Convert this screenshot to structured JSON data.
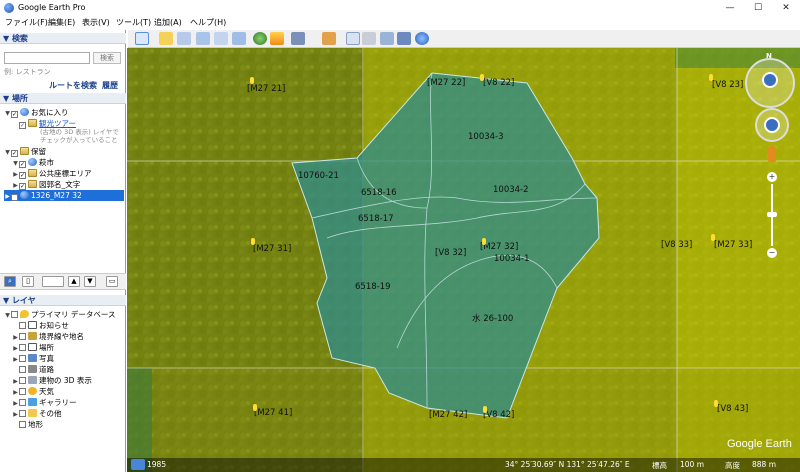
{
  "window": {
    "title": "Google Earth Pro",
    "minimize": "—",
    "maximize": "☐",
    "close": "✕"
  },
  "menu": [
    "ファイル(F)",
    "編集(E)",
    "表示(V)",
    "ツール(T)",
    "追加(A)",
    "ヘルプ(H)"
  ],
  "search": {
    "header": "▼ 検索",
    "placeholder": "",
    "button": "検索",
    "hint": "例: レストラン",
    "route": "ルートを検索",
    "history": "履歴"
  },
  "places": {
    "header": "▼ 場所",
    "items": [
      {
        "label": "お気に入り"
      },
      {
        "label": "観光ツアー"
      },
      {
        "label": "(古地の 3D 表示) レイヤで"
      },
      {
        "label": "チェックが入っていること"
      },
      {
        "label": "保留"
      },
      {
        "label": "萩市"
      },
      {
        "label": "公共座標エリア"
      },
      {
        "label": "図郭名_文字"
      },
      {
        "label": "1326_M27 32"
      }
    ]
  },
  "layers": {
    "header": "▼ レイヤ",
    "items": [
      {
        "label": "プライマリ データベース"
      },
      {
        "label": "お知らせ"
      },
      {
        "label": "境界線や地名"
      },
      {
        "label": "場所"
      },
      {
        "label": "写真"
      },
      {
        "label": "道路"
      },
      {
        "label": "建物の 3D 表示"
      },
      {
        "label": "天気"
      },
      {
        "label": "ギャラリー"
      },
      {
        "label": "その他"
      },
      {
        "label": "地形"
      }
    ]
  },
  "map": {
    "grid_labels": [
      "[M27 21]",
      "[M27 22]",
      "[V8 22]",
      "[V8 23]",
      "[M27 31]",
      "[V8 32]",
      "[M27 32]",
      "[V8 33]",
      "[M27 33]",
      "[M27 41]",
      "[M27 42]",
      "[V8 42]",
      "[V8 43]"
    ],
    "parcel_labels": [
      "10034-3",
      "10760-21",
      "6518-16",
      "6518-17",
      "10034-2",
      "10034-1",
      "6518-19",
      "水 26-100"
    ],
    "watermark": "Google Earth"
  },
  "status": {
    "year": "1985",
    "coords": "34° 25′30.69″ N   131° 25′47.26″ E",
    "elevation_label": "標高",
    "elevation_value": "100 m",
    "altitude_label": "高度",
    "altitude_value": "888 m"
  },
  "colors": {
    "accent": "#1e6fd9",
    "parcel_fill": "#2f8c8c",
    "yellow_overlay": "#d8d800"
  }
}
